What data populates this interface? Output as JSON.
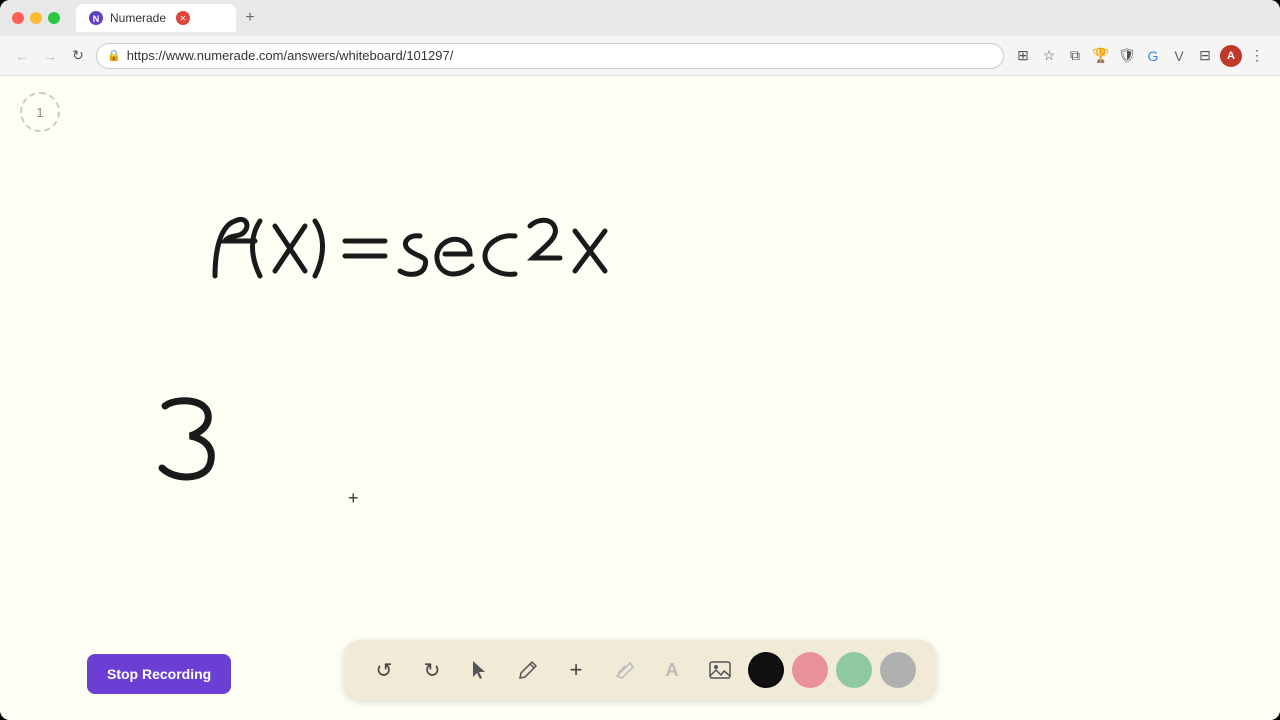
{
  "browser": {
    "tab_title": "Numerade",
    "tab_favicon": "N",
    "url": "https://www.numerade.com/answers/whiteboard/101297/",
    "nav": {
      "back_label": "←",
      "forward_label": "→",
      "refresh_label": "↻"
    }
  },
  "toolbar": {
    "undo_label": "↺",
    "redo_label": "↻",
    "select_label": "▲",
    "pen_label": "✏",
    "add_label": "+",
    "eraser_label": "/",
    "text_label": "A",
    "image_label": "🖼",
    "stop_recording_label": "Stop Recording"
  },
  "page_indicator": "1",
  "equation_display": "f(x) = sec2x",
  "number_display": "3",
  "cursor_symbol": "+",
  "colors": {
    "black": "#111111",
    "pink": "#e8919a",
    "green": "#8ec9a0",
    "gray": "#b0b0b0",
    "accent_purple": "#6b3fd4",
    "toolbar_bg": "#f0ead6"
  },
  "toolbar_icons": [
    {
      "name": "undo",
      "icon": "↺",
      "disabled": false
    },
    {
      "name": "redo",
      "icon": "↻",
      "disabled": false
    },
    {
      "name": "select",
      "icon": "▲",
      "disabled": false
    },
    {
      "name": "pen",
      "icon": "✏",
      "disabled": false
    },
    {
      "name": "add",
      "icon": "+",
      "disabled": false
    },
    {
      "name": "eraser",
      "icon": "/",
      "disabled": true
    },
    {
      "name": "text",
      "icon": "A",
      "disabled": true
    },
    {
      "name": "image",
      "icon": "IMG",
      "disabled": false
    }
  ]
}
